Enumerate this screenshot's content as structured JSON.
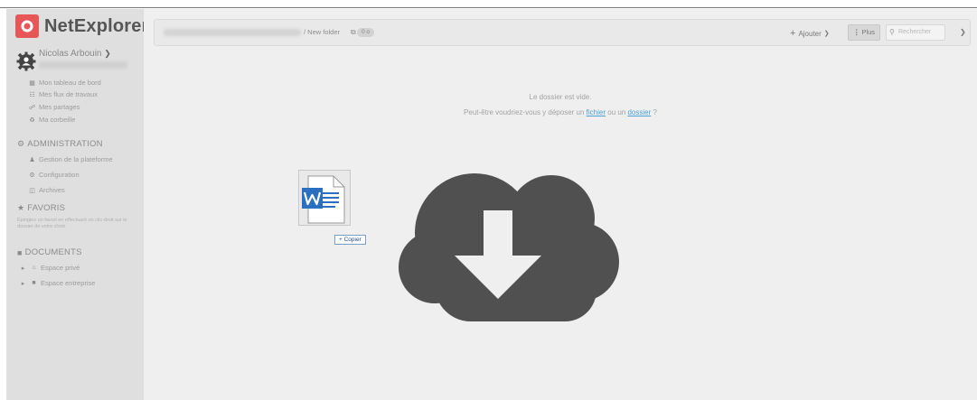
{
  "app": {
    "name": "NetExplorer",
    "brand_color": "#e85757"
  },
  "user": {
    "name": "Nicolas Arbouin",
    "icon": "user-gear-icon"
  },
  "nav": [
    {
      "icon": "dashboard-icon",
      "label": "Mon tableau de bord"
    },
    {
      "icon": "workflow-icon",
      "label": "Mes flux de travaux"
    },
    {
      "icon": "share-icon",
      "label": "Mes partages"
    },
    {
      "icon": "trash-icon",
      "label": "Ma corbeille"
    }
  ],
  "admin": {
    "title": "ADMINISTRATION",
    "items": [
      {
        "icon": "user-icon",
        "label": "Gestion de la plateforme"
      },
      {
        "icon": "gear-icon",
        "label": "Configuration"
      },
      {
        "icon": "archive-icon",
        "label": "Archives"
      }
    ]
  },
  "favoris": {
    "title": "FAVORIS",
    "hint": "Épinglez un favori en effectuant un clic-droit sur le dossier de votre choix"
  },
  "documents": {
    "title": "DOCUMENTS",
    "items": [
      {
        "icon": "home-icon",
        "label": "Espace privé"
      },
      {
        "icon": "folder-icon",
        "label": "Espace entreprise"
      }
    ]
  },
  "toolbar": {
    "crumb_current": "/ New folder",
    "size_badge": "0 o",
    "add_label": "Ajouter",
    "more_label": "Plus",
    "search_placeholder": "Rechercher"
  },
  "empty": {
    "line1": "Le dossier est vide.",
    "line2_prefix": "Peut-être voudriez-vous y déposer un ",
    "file_link": "fichier",
    "line2_mid": " ou un ",
    "folder_link": "dossier",
    "line2_suffix": " ?"
  },
  "drag": {
    "tooltip": "+ Copier",
    "file_icon": "word-file-icon"
  },
  "colors": {
    "sidebar": "#dfdfdf",
    "content": "#efefef",
    "cloud": "#505050",
    "link": "#4a9fd3",
    "word": "#2b6fc1"
  }
}
